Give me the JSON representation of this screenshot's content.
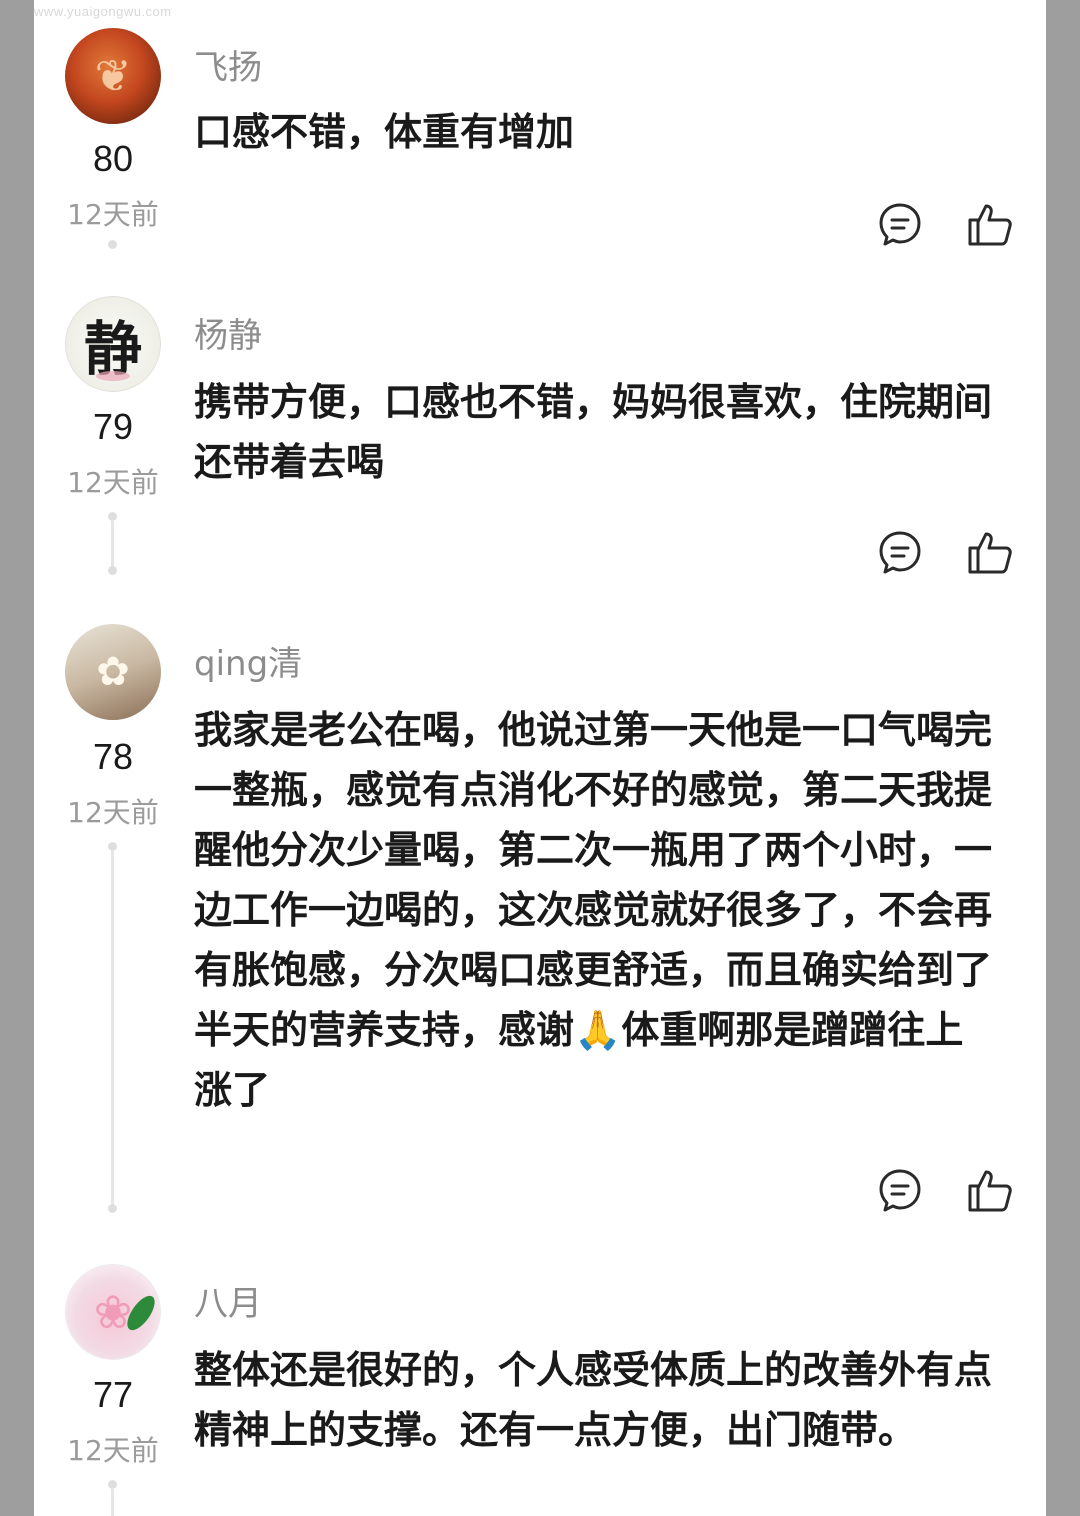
{
  "watermark": "www.yuaigongwu.com",
  "comments": [
    {
      "name": "飞扬",
      "text": "口感不错，体重有增加",
      "score": "80",
      "time": "12天前",
      "avatar_glyph": "❦"
    },
    {
      "name": "杨静",
      "text": "携带方便，口感也不错，妈妈很喜欢，住院期间还带着去喝",
      "score": "79",
      "time": "12天前",
      "avatar_glyph": "静"
    },
    {
      "name": "qing清",
      "text": "我家是老公在喝，他说过第一天他是一口气喝完一整瓶，感觉有点消化不好的感觉，第二天我提醒他分次少量喝，第二次一瓶用了两个小时，一边工作一边喝的，这次感觉就好很多了，不会再有胀饱感，分次喝口感更舒适，而且确实给到了半天的营养支持，感谢🙏体重啊那是蹭蹭往上涨了",
      "score": "78",
      "time": "12天前",
      "avatar_glyph": "✿"
    },
    {
      "name": "八月",
      "text": "整体还是很好的，个人感受体质上的改善外有点精神上的支撑。还有一点方便，出门随带。",
      "score": "77",
      "time": "12天前",
      "avatar_glyph": "❀"
    }
  ],
  "icons": {
    "reply": "comment-bubble-icon",
    "like": "thumbs-up-icon"
  },
  "colors": {
    "name": "#8c8c8c",
    "time": "#9b9b9b",
    "text": "#1a1a1a",
    "side_bar": "#9e9e9e"
  }
}
